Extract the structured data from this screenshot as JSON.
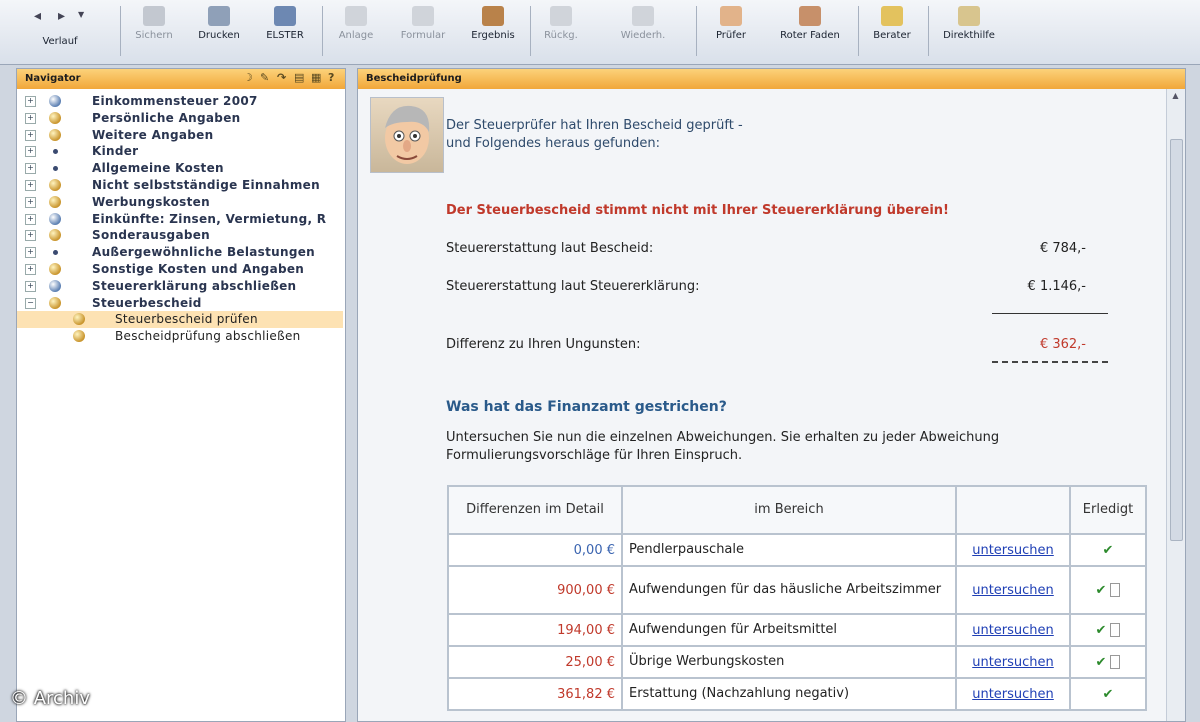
{
  "toolbar": {
    "buttons": [
      {
        "label": "Verlauf",
        "enabled": true
      },
      {
        "label": "Sichern",
        "enabled": false
      },
      {
        "label": "Drucken",
        "enabled": true
      },
      {
        "label": "ELSTER",
        "enabled": true
      },
      {
        "label": "Anlage",
        "enabled": false
      },
      {
        "label": "Formular",
        "enabled": false
      },
      {
        "label": "Ergebnis",
        "enabled": true
      },
      {
        "label": "Rückg.",
        "enabled": false
      },
      {
        "label": "Wiederh.",
        "enabled": false
      },
      {
        "label": "Prüfer",
        "enabled": true
      },
      {
        "label": "Roter Faden",
        "enabled": true
      },
      {
        "label": "Berater",
        "enabled": true
      },
      {
        "label": "Direkthilfe",
        "enabled": true
      }
    ]
  },
  "navigator": {
    "title": "Navigator",
    "items": [
      {
        "label": "Einkommensteuer 2007",
        "icon": "globe-icon"
      },
      {
        "label": "Persönliche Angaben",
        "icon": "person-icon"
      },
      {
        "label": "Weitere Angaben",
        "icon": "person-icon"
      },
      {
        "label": "Kinder",
        "icon": "dot-icon"
      },
      {
        "label": "Allgemeine Kosten",
        "icon": "dot-icon"
      },
      {
        "label": "Nicht selbstständige Einnahmen",
        "icon": "person-icon"
      },
      {
        "label": "Werbungskosten",
        "icon": "person-icon"
      },
      {
        "label": "Einkünfte: Zinsen, Vermietung, R",
        "icon": "globe-icon"
      },
      {
        "label": "Sonderausgaben",
        "icon": "person-icon"
      },
      {
        "label": "Außergewöhnliche Belastungen",
        "icon": "dot-icon"
      },
      {
        "label": "Sonstige Kosten und Angaben",
        "icon": "person-icon"
      },
      {
        "label": "Steuererklärung abschließen",
        "icon": "globe-icon"
      },
      {
        "label": "Steuerbescheid",
        "icon": "person-icon"
      }
    ],
    "children": [
      {
        "label": "Steuerbescheid prüfen",
        "selected": true
      },
      {
        "label": "Bescheidprüfung abschließen",
        "selected": false
      }
    ]
  },
  "main": {
    "title": "Bescheidprüfung",
    "intro_line1": "Der Steuerprüfer hat Ihren Bescheid geprüft -",
    "intro_line2": "und Folgendes heraus gefunden:",
    "warning": "Der Steuerbescheid stimmt nicht mit Ihrer Steuererklärung überein!",
    "refund_notice_label": "Steuererstattung laut Bescheid:",
    "refund_notice_value": "€ 784,-",
    "refund_return_label": "Steuererstattung laut Steuererklärung:",
    "refund_return_value": "€ 1.146,-",
    "difference_label": "Differenz zu Ihren Ungunsten:",
    "difference_value": "€ 362,-",
    "subheading": "Was hat das Finanzamt gestrichen?",
    "description": "Untersuchen Sie nun die einzelnen Abweichungen. Sie erhalten zu jeder Abweichung Formulierungsvorschläge für Ihren Einspruch.",
    "table": {
      "headers": [
        "Differenzen im Detail",
        "im Bereich",
        "",
        "Erledigt"
      ],
      "rows": [
        {
          "amount": "0,00 €",
          "area": "Pendlerpauschale",
          "link": "untersuchen",
          "done": "✔",
          "has_box": false,
          "color": "#3a64b0"
        },
        {
          "amount": "900,00 €",
          "area": "Aufwendungen für das häusliche Arbeitszimmer",
          "link": "untersuchen",
          "done": "✔",
          "has_box": true,
          "color": "#c0392b"
        },
        {
          "amount": "194,00 €",
          "area": "Aufwendungen für Arbeitsmittel",
          "link": "untersuchen",
          "done": "✔",
          "has_box": true,
          "color": "#c0392b"
        },
        {
          "amount": "25,00 €",
          "area": "Übrige Werbungskosten",
          "link": "untersuchen",
          "done": "✔",
          "has_box": true,
          "color": "#c0392b"
        },
        {
          "amount": "361,82 €",
          "area": "Erstattung (Nachzahlung negativ)",
          "link": "untersuchen",
          "done": "✔",
          "has_box": false,
          "color": "#c0392b"
        }
      ]
    }
  },
  "watermark": "© Archiv"
}
